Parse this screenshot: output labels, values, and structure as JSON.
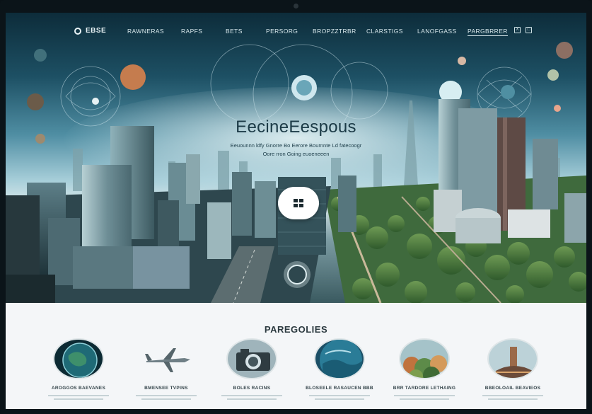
{
  "nav": {
    "logo": "EBSE",
    "links": [
      "RAWNERAS",
      "RAPFS",
      "BETS",
      "PERSORG",
      "BROPZZTRBR",
      "CLARSTIGS",
      "LANOFGASS",
      "PARGBRRER"
    ],
    "active_index": 7,
    "social": [
      {
        "icon": "twitter-icon",
        "glyph": "X"
      },
      {
        "icon": "share-icon",
        "glyph": "□"
      }
    ]
  },
  "hero": {
    "title": "EecineEespous",
    "subtitle_line1": "Eeuounnn ldfy Gnorre Bo Eerore Bournnte Ld fatecoogr",
    "subtitle_line2": "Oore rron Going euoeneeen",
    "cta_icon": "grid-icon"
  },
  "section": {
    "title": "PAREGOLIES",
    "cards": [
      {
        "label": "AROGGOS BAEVANES",
        "thumb": "earth-globe-icon"
      },
      {
        "label": "BMENSEE TVPINS",
        "thumb": "airplane-icon"
      },
      {
        "label": "BOLES RACINS",
        "thumb": "camera-icon"
      },
      {
        "label": "BLOSEELE RASAUCEN BBB",
        "thumb": "ocean-planet-icon"
      },
      {
        "label": "BRR TARDORE LETHAING",
        "thumb": "landscape-icon"
      },
      {
        "label": "BBEOLOAIL BEAVIEOS",
        "thumb": "landmark-icon"
      }
    ]
  },
  "colors": {
    "accent_teal": "#1d5064",
    "sky_light": "#a8cfda",
    "section_bg": "#f4f6f8"
  }
}
